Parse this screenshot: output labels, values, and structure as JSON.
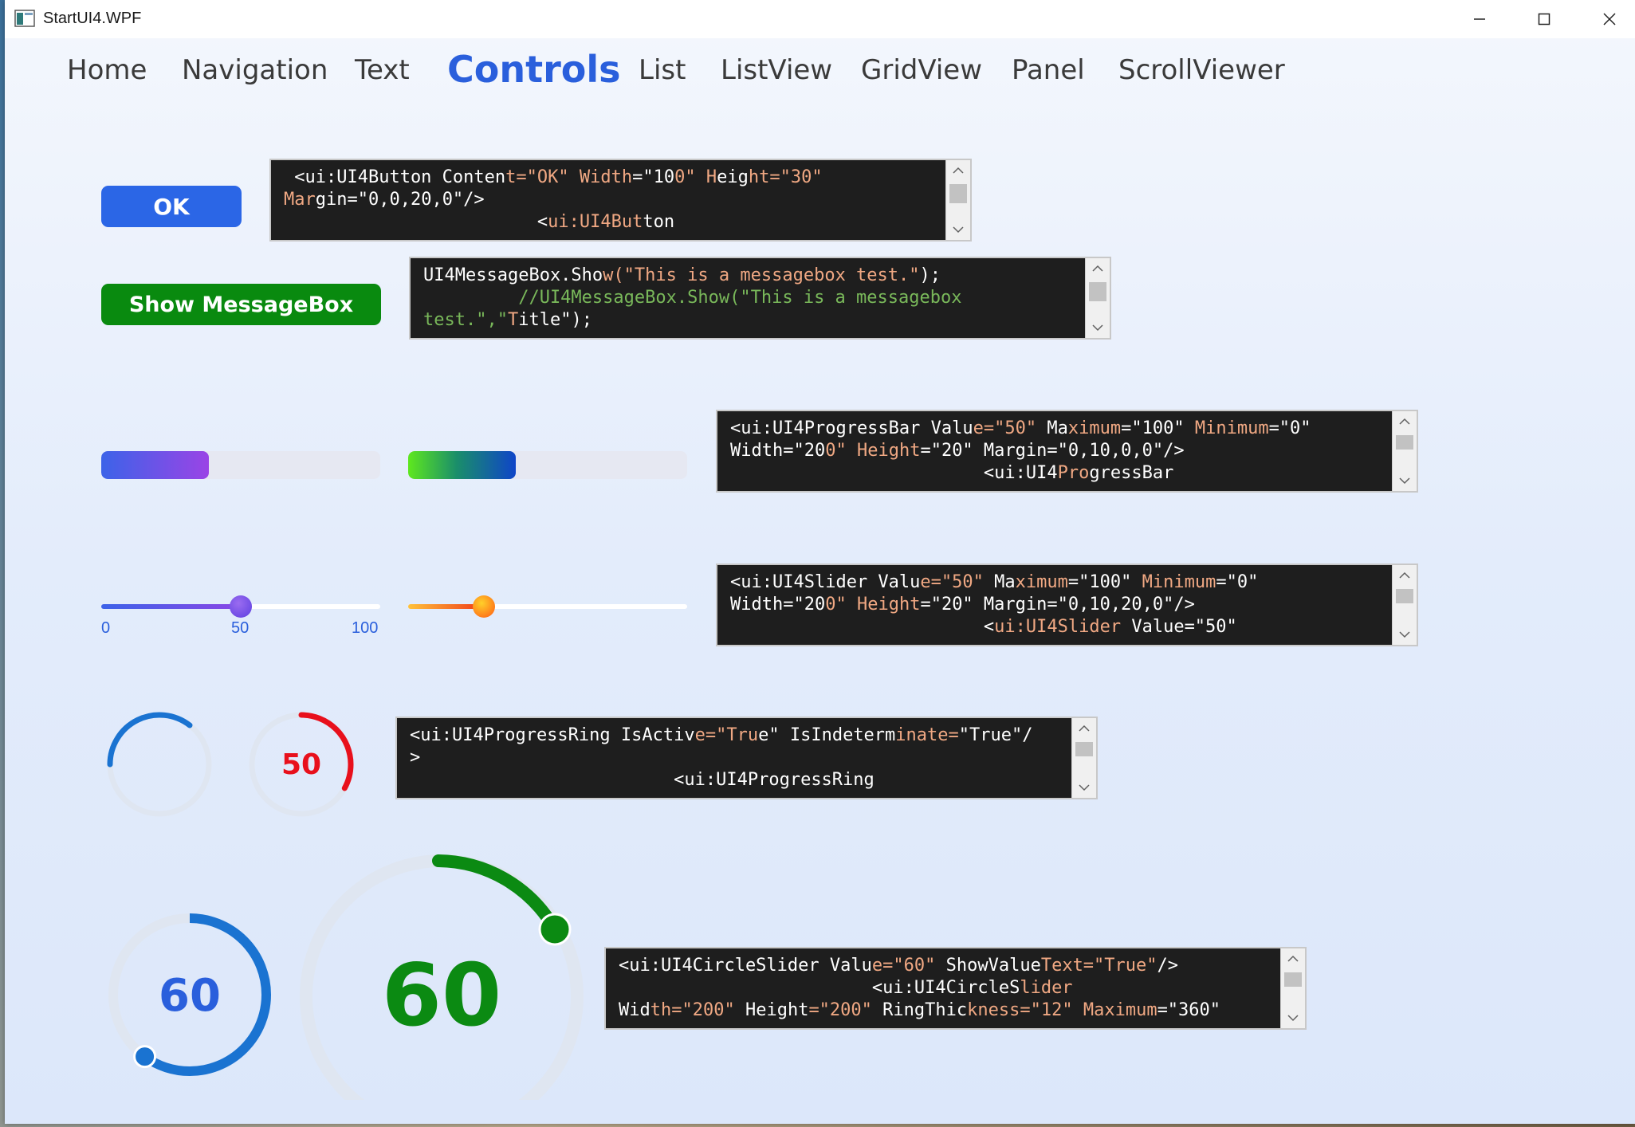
{
  "window": {
    "title": "StartUI4.WPF"
  },
  "nav": {
    "items": [
      "Home",
      "Navigation",
      "Text",
      "Controls",
      "List",
      "ListView",
      "GridView",
      "Panel",
      "ScrollViewer"
    ],
    "active": "Controls"
  },
  "buttons": {
    "ok_label": "OK",
    "msgbox_label": "Show MessageBox"
  },
  "code": {
    "button": {
      "l1_a": " <ui:UI4Button Conten",
      "l1_b": "t=\"OK\"",
      "l1_c": " ",
      "l1_d": "Width",
      "l1_e": "=\"10",
      "l1_f": "0\" ",
      "l1_g": "H",
      "l1_h": "eig",
      "l1_i": "ht",
      "l1_j": "=\"30\"",
      "l2_a": "Mar",
      "l2_b": "gin=\"0,0,20,0\"/>",
      "l3_a": "                        <",
      "l3_b": "ui:UI4But",
      "l3_c": "ton"
    },
    "msgbox": {
      "l1_a": "UI4MessageBox.Sho",
      "l1_b": "w(\"This is a messagebox test.\"",
      "l1_c": ");",
      "l2_a": "         //UI4MessageBox.Show(\"This is a messagebox",
      "l3_a": "test.\",\"",
      "l3_b": "T",
      "l3_c": "itle\");"
    },
    "progressbar": {
      "l1_a": "<ui:UI4ProgressBar Valu",
      "l1_b": "e=\"50\"",
      "l1_c": " Ma",
      "l1_d": "ximum",
      "l1_e": "=\"100\"",
      "l1_f": " ",
      "l1_g": "Minimum",
      "l1_h": "=\"0\"",
      "l2_a": "Width=\"20",
      "l2_b": "0\" ",
      "l2_c": "Height",
      "l2_d": "=\"20\" Margin=\"0,10,0,0\"/>",
      "l3_a": "                        <ui:UI4",
      "l3_b": "Pro",
      "l3_c": "gressBar"
    },
    "slider": {
      "l1_a": "<ui:UI4Slider Valu",
      "l1_b": "e=\"50\"",
      "l1_c": " Ma",
      "l1_d": "ximum",
      "l1_e": "=\"100\"",
      "l1_f": " ",
      "l1_g": "Minimum",
      "l1_h": "=\"0\"",
      "l2_a": "Width=\"20",
      "l2_b": "0\" ",
      "l2_c": "Height",
      "l2_d": "=\"20\" Margin=\"0,10,20,0\"/>",
      "l3_a": "                        <",
      "l3_b": "ui:UI4Slid",
      "l3_c": "er",
      "l3_d": " Value=\"50\""
    },
    "ring": {
      "l1_a": "<ui:UI4ProgressRing IsActiv",
      "l1_b": "e=\"Tru",
      "l1_c": "e\" IsIndeterm",
      "l1_d": "inate=",
      "l1_e": "\"True\"/",
      "l2_a": ">",
      "l3_a": "                         <ui:UI4ProgressRing"
    },
    "circle": {
      "l1_a": "<ui:UI4CircleSlider Valu",
      "l1_b": "e=\"60\"",
      "l1_c": " ShowValue",
      "l1_d": "Text=\"True\"",
      "l1_e": "/>",
      "l2_a": "                        <ui:UI4CircleS",
      "l2_b": "lider",
      "l3_a": "Wid",
      "l3_b": "th=\"200\"",
      "l3_c": " Height",
      "l3_d": "=\"200\"",
      "l3_e": " RingThic",
      "l3_f": "kness=\"12\" ",
      "l3_g": "Maximum",
      "l3_h": "=\"360\""
    }
  },
  "progress": {
    "bar1": {
      "value": 50,
      "max": 100
    },
    "bar2": {
      "value": 50,
      "max": 100
    }
  },
  "sliders": {
    "slider1": {
      "value": 50,
      "min": 0,
      "max": 100,
      "tick_min": "0",
      "tick_mid": "50",
      "tick_max": "100"
    },
    "slider2": {
      "value": 27,
      "min": 0,
      "max": 100
    }
  },
  "rings": {
    "ring2_value": "50",
    "ring2_fraction": 0.33
  },
  "circle_sliders": {
    "small": {
      "value": "60",
      "fraction": 0.6
    },
    "big": {
      "value": "60"
    }
  },
  "colors": {
    "accent": "#2a5fdc",
    "ok_button": "#2b66e6",
    "msgbox_button": "#098a0f",
    "ring_red": "#e8101c",
    "circle_blue": "#1a73d1",
    "circle_green": "#0b8a12"
  }
}
